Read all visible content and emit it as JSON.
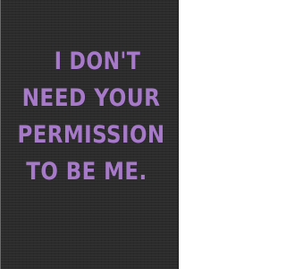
{
  "cover": {
    "background_color": "#2b2b2b",
    "text_color": "#a779c9",
    "quote_lines": [
      "I DON'T",
      "NEED YOUR",
      "PERMISSION",
      "TO BE ME."
    ]
  }
}
